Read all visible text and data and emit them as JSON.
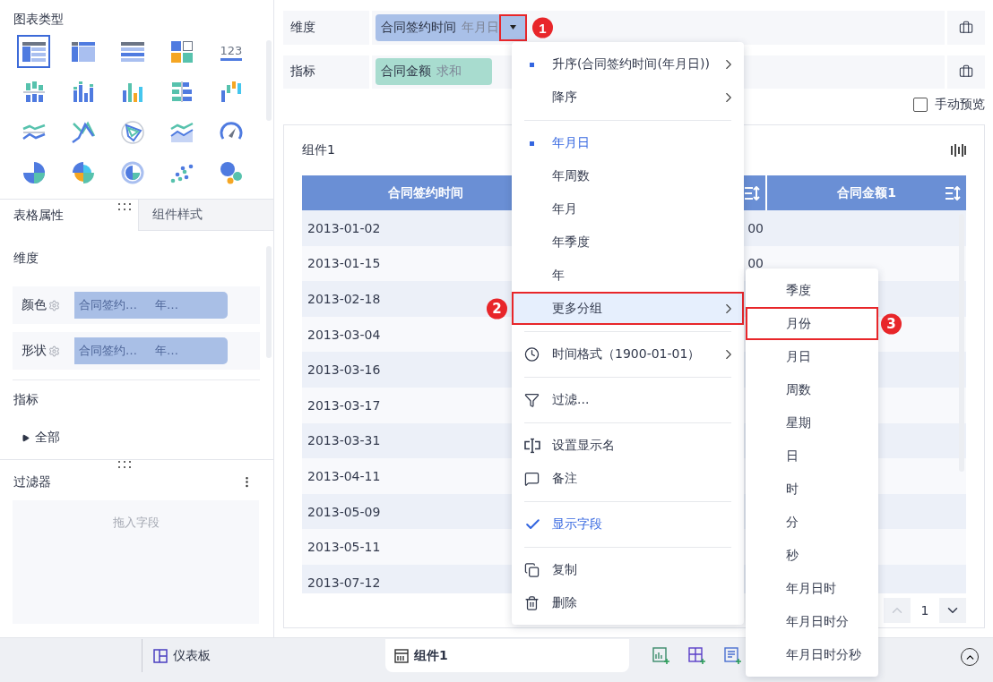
{
  "chart_panel": {
    "title": "图表类型",
    "types": [
      {
        "kind": "table",
        "selected": true
      },
      {
        "kind": "cross-table",
        "selected": false
      },
      {
        "kind": "list-table",
        "selected": false
      },
      {
        "kind": "tiles",
        "selected": false
      },
      {
        "kind": "number",
        "text": "123",
        "selected": false
      },
      {
        "kind": "range-bar",
        "selected": false
      },
      {
        "kind": "stacked-bar",
        "selected": false
      },
      {
        "kind": "bar",
        "selected": false
      },
      {
        "kind": "horizontal-bar",
        "selected": false
      },
      {
        "kind": "waterfall",
        "selected": false
      },
      {
        "kind": "line",
        "selected": false
      },
      {
        "kind": "crossing-line",
        "selected": false
      },
      {
        "kind": "radar",
        "selected": false
      },
      {
        "kind": "area",
        "selected": false
      },
      {
        "kind": "gauge",
        "selected": false
      },
      {
        "kind": "pie",
        "selected": false
      },
      {
        "kind": "rose",
        "selected": false
      },
      {
        "kind": "ring",
        "selected": false
      },
      {
        "kind": "scatter",
        "selected": false
      },
      {
        "kind": "bubble",
        "selected": false
      }
    ]
  },
  "property_tabs": [
    {
      "label": "表格属性",
      "selected": true
    },
    {
      "label": "组件样式",
      "selected": false
    }
  ],
  "properties": {
    "dimension_title": "维度",
    "fields": [
      {
        "label": "颜色",
        "field": "合同签约…",
        "group": "年…"
      },
      {
        "label": "形状",
        "field": "合同签约…",
        "group": "年…"
      }
    ],
    "measure_title": "指标",
    "tree": [
      {
        "label": "全部",
        "expanded": false
      }
    ]
  },
  "filter_panel": {
    "title": "过滤器",
    "placeholder": "拖入字段"
  },
  "dimension_row": {
    "label": "维度",
    "chip": {
      "field": "合同签约时间",
      "group": "年月日",
      "annotation": "1"
    }
  },
  "measure_row": {
    "label": "指标",
    "chips": [
      {
        "field": "合同金额",
        "agg": "求和"
      }
    ]
  },
  "manual_preview": {
    "label": "手动预览",
    "checked": false
  },
  "component": {
    "title": "组件1",
    "columns": [
      {
        "label": "合同签约时间",
        "sort_icon": false
      },
      {
        "sort_icon": true
      },
      {
        "label": "合同金额1",
        "sort_icon": true
      }
    ],
    "rows": [
      {
        "date": "2013-01-02",
        "column_2": "00"
      },
      {
        "date": "2013-01-15",
        "column_2": "00"
      },
      {
        "date": "2013-02-18"
      },
      {
        "date": "2013-03-04"
      },
      {
        "date": "2013-03-16"
      },
      {
        "date": "2013-03-17"
      },
      {
        "date": "2013-03-31"
      },
      {
        "date": "2013-04-11"
      },
      {
        "date": "2013-05-09"
      },
      {
        "date": "2013-05-11"
      },
      {
        "date": "2013-07-12"
      }
    ],
    "page": "1"
  },
  "context_menu": [
    {
      "kind": "dot",
      "label": "升序(合同签约时间(年月日))",
      "selected": false,
      "submenu": true
    },
    {
      "kind": "plain",
      "label": "降序",
      "selected": false,
      "submenu": true
    },
    {
      "kind": "divider"
    },
    {
      "kind": "dot",
      "label": "年月日",
      "selected": true,
      "submenu": false
    },
    {
      "kind": "plain",
      "label": "年周数",
      "selected": false,
      "submenu": false
    },
    {
      "kind": "plain",
      "label": "年月",
      "selected": false,
      "submenu": false
    },
    {
      "kind": "plain",
      "label": "年季度",
      "selected": false,
      "submenu": false
    },
    {
      "kind": "plain",
      "label": "年",
      "selected": false,
      "submenu": false
    },
    {
      "kind": "plain",
      "label": "更多分组",
      "selected": false,
      "highlighted": true,
      "submenu": true,
      "annotation": "2"
    },
    {
      "kind": "divider"
    },
    {
      "kind": "clock",
      "label": "时间格式（1900-01-01）",
      "selected": false,
      "submenu": true
    },
    {
      "kind": "divider"
    },
    {
      "kind": "filter",
      "label": "过滤...",
      "selected": false,
      "submenu": false
    },
    {
      "kind": "divider"
    },
    {
      "kind": "rename",
      "label": "设置显示名",
      "selected": false,
      "submenu": false
    },
    {
      "kind": "note",
      "label": "备注",
      "selected": false,
      "submenu": false
    },
    {
      "kind": "divider"
    },
    {
      "kind": "check",
      "label": "显示字段",
      "selected": true,
      "submenu": false
    },
    {
      "kind": "divider"
    },
    {
      "kind": "copy",
      "label": "复制",
      "selected": false,
      "submenu": false
    },
    {
      "kind": "delete",
      "label": "删除",
      "selected": false,
      "submenu": false
    }
  ],
  "submenu": [
    {
      "label": "季度"
    },
    {
      "label": "月份",
      "annotation": "3"
    },
    {
      "label": "月日"
    },
    {
      "label": "周数"
    },
    {
      "label": "星期"
    },
    {
      "label": "日"
    },
    {
      "label": "时"
    },
    {
      "label": "分"
    },
    {
      "label": "秒"
    },
    {
      "label": "年月日时"
    },
    {
      "label": "年月日时分"
    },
    {
      "label": "年月日时分秒"
    }
  ],
  "bottom_tabs": [
    {
      "label": "仪表板",
      "kind": "dashboard",
      "selected": false
    },
    {
      "label": "组件1",
      "kind": "table",
      "selected": true
    }
  ]
}
